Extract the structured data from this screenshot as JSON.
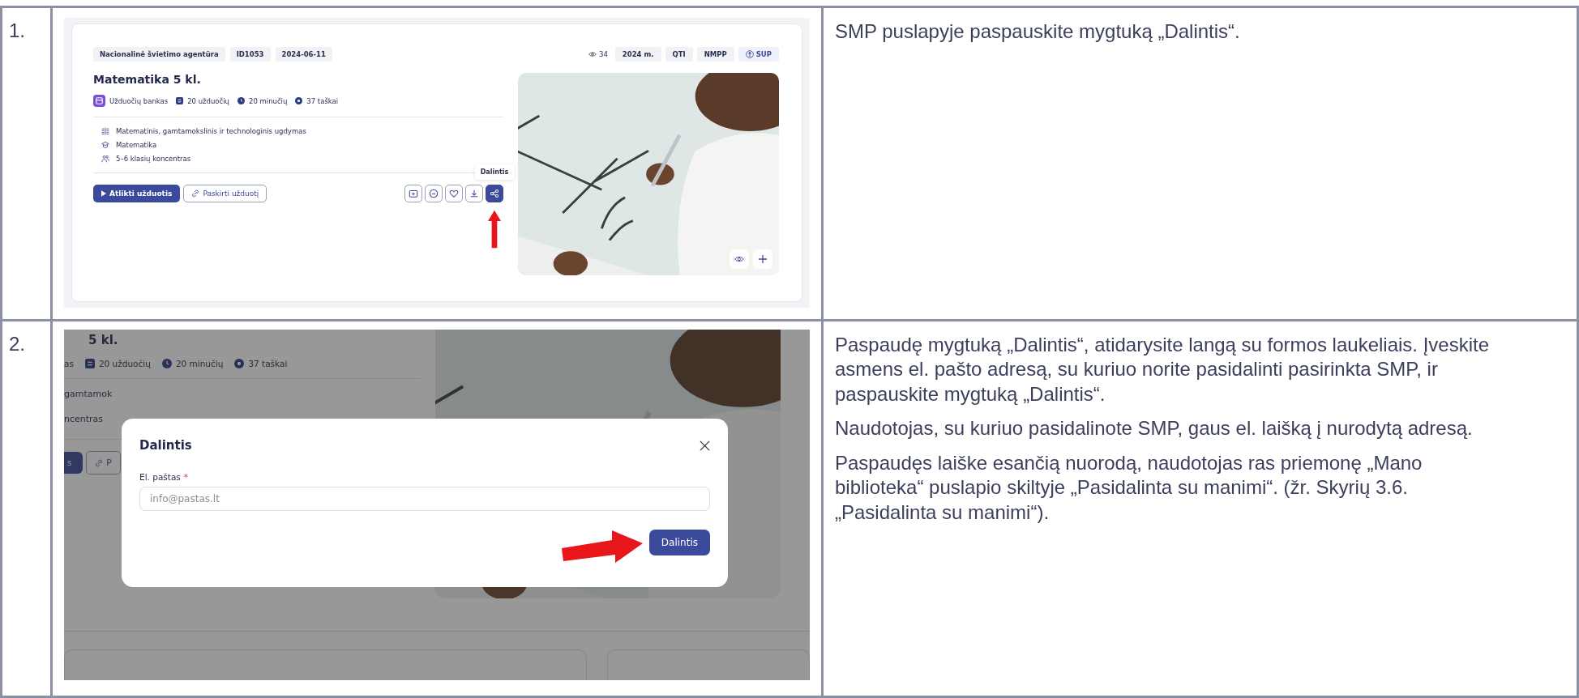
{
  "steps": [
    {
      "number": "1.",
      "screenshot": {
        "kind": "card",
        "tags": [
          "Nacionalinė švietimo agentūra",
          "ID1053",
          "2024-06-11"
        ],
        "views": "34",
        "badges": [
          {
            "label": "2024 m.",
            "kind": "plain"
          },
          {
            "label": "QTI",
            "kind": "plain"
          },
          {
            "label": "NMPP",
            "kind": "plain"
          },
          {
            "label": "SUP",
            "kind": "accessible"
          }
        ],
        "title": "Matematika 5 kl.",
        "meta": [
          {
            "kind": "bank",
            "label": "Užduočių bankas"
          },
          {
            "kind": "tasks",
            "label": "20 užduočių"
          },
          {
            "kind": "time",
            "label": "20 minučių"
          },
          {
            "kind": "points",
            "label": "37 taškai"
          }
        ],
        "details": [
          {
            "kind": "area",
            "label": "Matematinis, gamtamokslinis ir technologinis ugdymas"
          },
          {
            "kind": "subject",
            "label": "Matematika"
          },
          {
            "kind": "group",
            "label": "5–6 klasių koncentras"
          }
        ],
        "primary_button": "Atlikti užduotis",
        "secondary_button": "Paskirti užduotį",
        "icon_buttons": [
          {
            "kind": "folder",
            "selected": false
          },
          {
            "kind": "minus",
            "selected": false
          },
          {
            "kind": "heart",
            "selected": false
          },
          {
            "kind": "download",
            "selected": false
          },
          {
            "kind": "share",
            "selected": true
          }
        ],
        "tooltip": "Dalintis"
      },
      "paragraphs": [
        "SMP puslapyje paspauskite mygtuką „Dalintis“."
      ]
    },
    {
      "number": "2.",
      "screenshot": {
        "kind": "dialog",
        "title": "5 kl.",
        "meta": [
          {
            "label": "as"
          },
          {
            "kind": "tasks",
            "label": "20 užduočių"
          },
          {
            "kind": "time",
            "label": "20 minučių"
          },
          {
            "kind": "points",
            "label": "37 taškai"
          }
        ],
        "details": [
          "gamtamok",
          "ncentras"
        ],
        "primary_button": "s",
        "secondary_button": "P",
        "dialog": {
          "title": "Dalintis",
          "field_label": "El. paštas",
          "required_mark": "*",
          "placeholder": "info@pastas.lt",
          "submit": "Dalintis"
        }
      },
      "paragraphs": [
        "Paspaudę mygtuką „Dalintis“, atidarysite langą su formos laukeliais. Įveskite asmens el. pašto adresą, su kuriuo norite pasidalinti pasirinkta SMP, ir paspauskite mygtuką „Dalintis“.",
        "Naudotojas, su kuriuo pasidalinote SMP, gaus el. laišką į nurodytą adresą.",
        "Paspaudęs laiške esančią nuorodą, naudotojas ras priemonę „Mano biblioteka“ puslapio skiltyje „Pasidalinta su manimi“. (žr. Skyrių 3.6. „Pasidalinta su manimi“)."
      ]
    }
  ]
}
